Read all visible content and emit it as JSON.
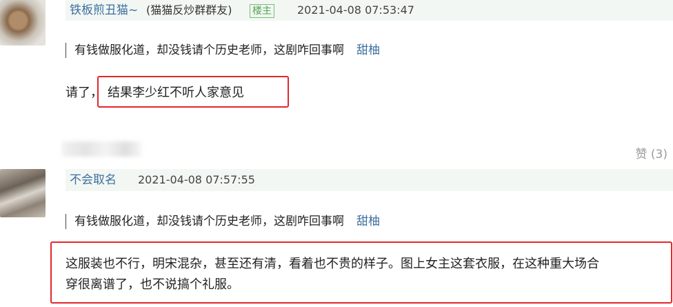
{
  "comments": [
    {
      "username": "铁板煎丑猫~",
      "group_tag": "(猫猫反炒群群友)",
      "badge": "楼主",
      "timestamp": "2021-04-08 07:53:47",
      "quote_text": "有钱做服化道，却没钱请个历史老师，这剧咋回事啊",
      "quote_author": "甜柚",
      "reply_prefix": "请了，",
      "reply_highlight": "结果李少红不听人家意见",
      "like_label": "赞 (3)"
    },
    {
      "username": "不会取名",
      "timestamp": "2021-04-08 07:57:55",
      "quote_text": "有钱做服化道，却没钱请个历史老师，这剧咋回事啊",
      "quote_author": "甜柚",
      "reply_line1": "这服装也不行，明宋混杂，甚至还有清，看着也不贵的样子。图上女主这套衣服，在这种重大场合",
      "reply_line2": "穿很离谱了，也不说搞个礼服。"
    }
  ],
  "colors": {
    "highlight_box": "#e2262b",
    "username": "#3d6f9e",
    "header_bg": "#f2f7f4"
  }
}
